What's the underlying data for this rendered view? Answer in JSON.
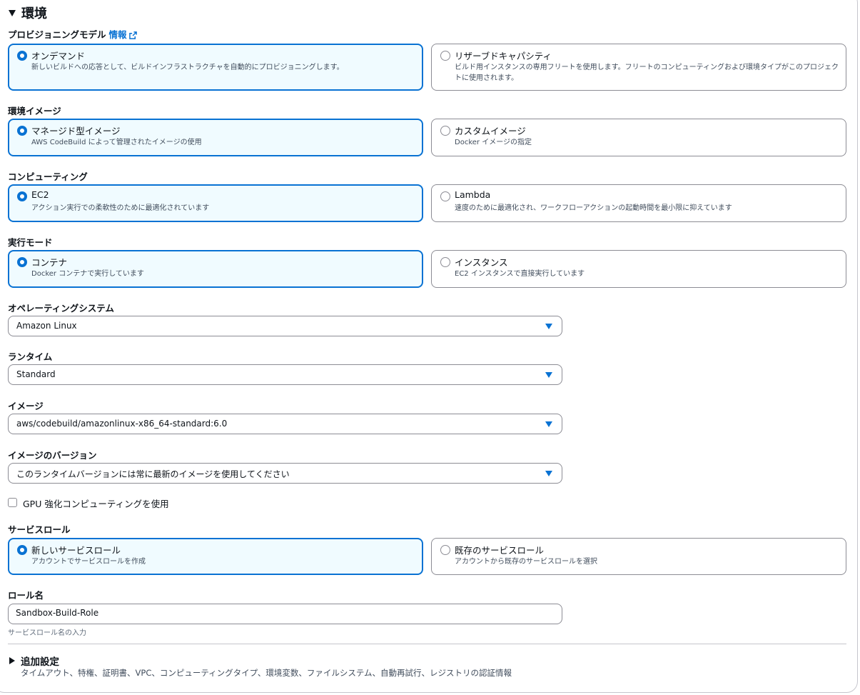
{
  "section": {
    "title": "環境"
  },
  "provisioning": {
    "label": "プロビジョニングモデル",
    "info_link": "情報",
    "options": [
      {
        "title": "オンデマンド",
        "desc": "新しいビルドへの応答として、ビルドインフラストラクチャを自動的にプロビジョニングします。",
        "selected": true
      },
      {
        "title": "リザーブドキャパシティ",
        "desc": "ビルド用インスタンスの専用フリートを使用します。フリートのコンピューティングおよび環境タイプがこのプロジェクトに使用されます。",
        "selected": false
      }
    ]
  },
  "env_image": {
    "label": "環境イメージ",
    "options": [
      {
        "title": "マネージド型イメージ",
        "desc": "AWS CodeBuild によって管理されたイメージの使用",
        "selected": true
      },
      {
        "title": "カスタムイメージ",
        "desc": "Docker イメージの指定",
        "selected": false
      }
    ]
  },
  "compute": {
    "label": "コンピューティング",
    "options": [
      {
        "title": "EC2",
        "desc": "アクション実行での柔軟性のために最適化されています",
        "selected": true
      },
      {
        "title": "Lambda",
        "desc": "速度のために最適化され、ワークフローアクションの起動時間を最小限に抑えています",
        "selected": false
      }
    ]
  },
  "run_mode": {
    "label": "実行モード",
    "options": [
      {
        "title": "コンテナ",
        "desc": "Docker コンテナで実行しています",
        "selected": true
      },
      {
        "title": "インスタンス",
        "desc": "EC2 インスタンスで直接実行しています",
        "selected": false
      }
    ]
  },
  "os": {
    "label": "オペレーティングシステム",
    "value": "Amazon Linux"
  },
  "runtime": {
    "label": "ランタイム",
    "value": "Standard"
  },
  "image": {
    "label": "イメージ",
    "value": "aws/codebuild/amazonlinux-x86_64-standard:6.0"
  },
  "image_version": {
    "label": "イメージのバージョン",
    "value": "このランタイムバージョンには常に最新のイメージを使用してください"
  },
  "gpu": {
    "label": "GPU 強化コンピューティングを使用",
    "checked": false
  },
  "service_role": {
    "label": "サービスロール",
    "options": [
      {
        "title": "新しいサービスロール",
        "desc": "アカウントでサービスロールを作成",
        "selected": true
      },
      {
        "title": "既存のサービスロール",
        "desc": "アカウントから既存のサービスロールを選択",
        "selected": false
      }
    ]
  },
  "role_name": {
    "label": "ロール名",
    "value": "Sandbox-Build-Role",
    "hint": "サービスロール名の入力"
  },
  "additional": {
    "title": "追加設定",
    "desc": "タイムアウト、特権、証明書、VPC、コンピューティングタイプ、環境変数、ファイルシステム、自動再試行、レジストリの認証情報"
  },
  "colors": {
    "accent": "#0972d3",
    "selected_bg": "#f0fbff",
    "border": "#8c8c94"
  }
}
